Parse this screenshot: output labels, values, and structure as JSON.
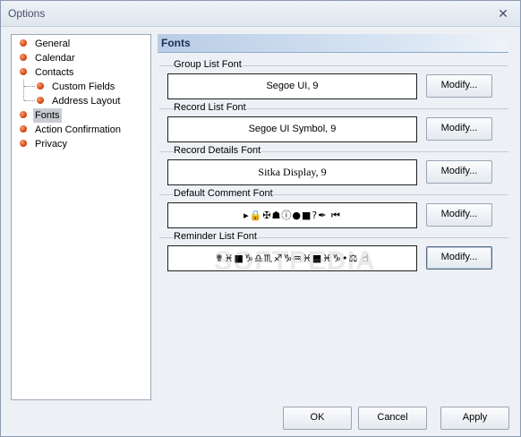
{
  "window": {
    "title": "Options",
    "close_glyph": "✕"
  },
  "tree": {
    "items": [
      {
        "label": "General"
      },
      {
        "label": "Calendar"
      },
      {
        "label": "Contacts"
      },
      {
        "label": "Custom Fields"
      },
      {
        "label": "Address Layout"
      },
      {
        "label": "Fonts"
      },
      {
        "label": "Action Confirmation"
      },
      {
        "label": "Privacy"
      }
    ],
    "selected": "Fonts"
  },
  "section": {
    "title": "Fonts"
  },
  "groups": [
    {
      "label": "Group List Font",
      "font_value": "Segoe UI, 9",
      "button": "Modify..."
    },
    {
      "label": "Record List Font",
      "font_value": "Segoe UI Symbol, 9",
      "button": "Modify..."
    },
    {
      "label": "Record Details Font",
      "font_value": "Sitka Display, 9",
      "button": "Modify..."
    },
    {
      "label": "Default Comment Font",
      "font_value": "▸🔒✠☗ⓘ●■?✒ ⏮",
      "button": "Modify..."
    },
    {
      "label": "Reminder List Font",
      "font_value": "✟♓■♑♎♏♐♑♒♓■♓♑•⚖ ☝",
      "button": "Modify..."
    }
  ],
  "buttons": {
    "ok": "OK",
    "cancel": "Cancel",
    "apply": "Apply"
  },
  "watermark": "SOFTPEDIA"
}
